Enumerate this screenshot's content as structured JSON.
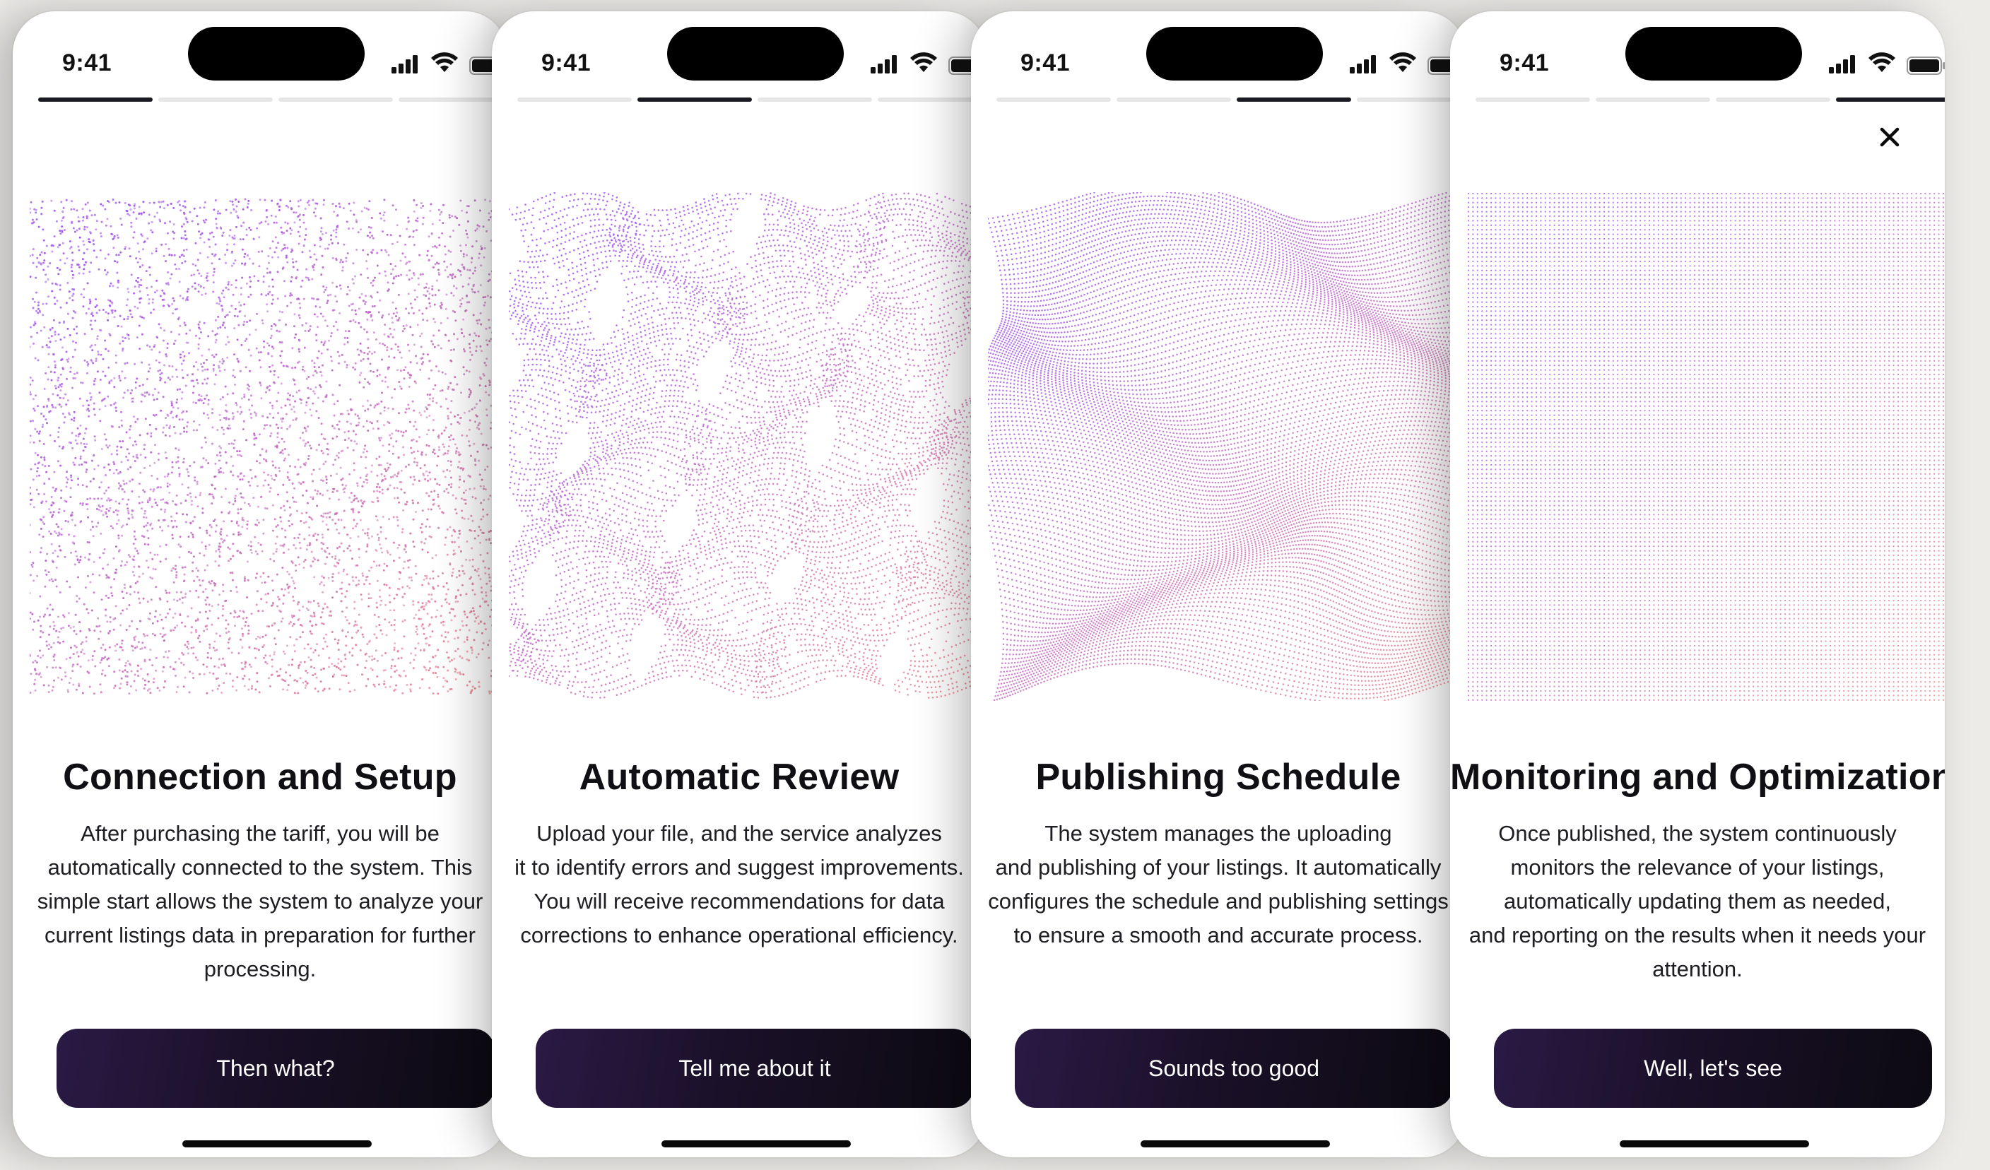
{
  "status_bar": {
    "time": "9:41"
  },
  "colors": {
    "dot_start": "#a35af0",
    "dot_end": "#f08a8a",
    "button_dark": "#1a1028",
    "progress_active": "#1a1a22",
    "progress_inactive": "#e6e6e6"
  },
  "screens": [
    {
      "step": 1,
      "title": "Connection and Setup",
      "body_lines": [
        "After purchasing the tariff, you will be",
        "automatically connected to the system. This",
        "simple start allows the system to analyze your",
        "current listings data in preparation for further",
        "processing."
      ],
      "cta": "Then what?",
      "pattern": "scatter"
    },
    {
      "step": 2,
      "title": "Automatic Review",
      "body_lines": [
        "Upload your file, and the service analyzes",
        "it to identify errors and suggest improvements.",
        "You will receive recommendations for data",
        "corrections to enhance operational efficiency."
      ],
      "cta": "Tell me about it",
      "pattern": "zigzag"
    },
    {
      "step": 3,
      "title": "Publishing Schedule",
      "body_lines": [
        "The system manages the uploading",
        "and publishing of your listings. It automatically",
        "configures the schedule and publishing settings",
        "to ensure a smooth and accurate process."
      ],
      "cta": "Sounds too good",
      "pattern": "wave"
    },
    {
      "step": 4,
      "title": "Monitoring and Optimization",
      "body_lines": [
        "Once published, the system continuously",
        "monitors the relevance of your listings,",
        "automatically updating them as needed,",
        "and reporting on the results when it needs your",
        "attention."
      ],
      "cta": "Well, let's see",
      "pattern": "grid",
      "close_icon": "close-icon"
    }
  ],
  "progress": {
    "total_steps": 4
  }
}
